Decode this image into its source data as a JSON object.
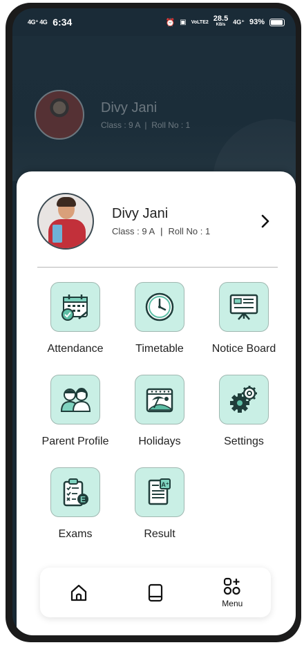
{
  "status_bar": {
    "signal_left": "4G⁺ 4G",
    "time": "6:34",
    "volte": "VoLTE2",
    "speed": "28.5",
    "speed_unit": "KB/s",
    "network": "4G⁺",
    "battery": "93%"
  },
  "header_background": {
    "name": "Divy Jani",
    "class_info": "Class : 9 A",
    "roll_info": "Roll No : 1"
  },
  "profile": {
    "name": "Divy Jani",
    "class_info": "Class : 9 A",
    "separator": "|",
    "roll_info": "Roll No : 1"
  },
  "menu_items": [
    {
      "label": "Attendance",
      "icon": "calendar-check-icon"
    },
    {
      "label": "Timetable",
      "icon": "clock-icon"
    },
    {
      "label": "Notice Board",
      "icon": "presentation-board-icon"
    },
    {
      "label": "Parent Profile",
      "icon": "parents-icon"
    },
    {
      "label": "Holidays",
      "icon": "beach-calendar-icon"
    },
    {
      "label": "Settings",
      "icon": "gears-icon"
    },
    {
      "label": "Exams",
      "icon": "exam-clipboard-icon"
    },
    {
      "label": "Result",
      "icon": "result-document-icon"
    }
  ],
  "bottom_nav": {
    "home_icon": "home-icon",
    "book_icon": "book-icon",
    "menu_label": "Menu"
  },
  "colors": {
    "header_bg": "#1b2d39",
    "tile_bg": "#c9efe5",
    "tile_border": "#9fb7b0",
    "icon_stroke": "#1f3d3a"
  }
}
